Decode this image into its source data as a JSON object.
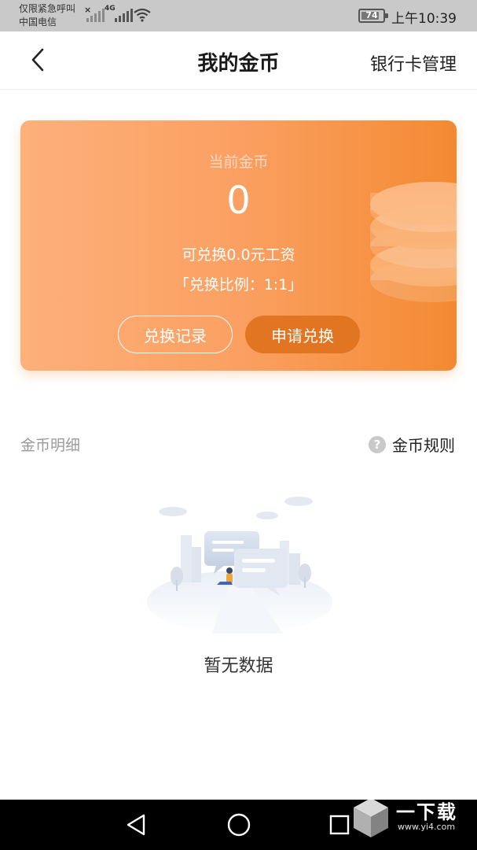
{
  "status_bar": {
    "emergency_text": "仅限紧急呼叫",
    "carrier": "中国电信",
    "network_type": "4G",
    "battery_level": "74",
    "time": "上午10:39"
  },
  "header": {
    "title": "我的金币",
    "bank_card_link": "银行卡管理",
    "back_icon": "chevron-left-icon"
  },
  "coin_card": {
    "label": "当前金币",
    "balance": "0",
    "exchangeable": "可兑换0.0元工资",
    "ratio": "「兑换比例：1:1」",
    "record_button": "兑换记录",
    "apply_button": "申请兑换",
    "accent_color": "#f38a32",
    "apply_button_color": "#e27522"
  },
  "details": {
    "title": "金币明细",
    "rules_link": "金币规则",
    "rules_icon": "question-icon",
    "empty_text": "暂无数据"
  },
  "nav_bar": {
    "back_icon": "triangle-back-icon",
    "home_icon": "circle-home-icon",
    "recent_icon": "square-recent-icon"
  },
  "watermark": {
    "text": "一下载",
    "url": "www.yi4.com"
  }
}
